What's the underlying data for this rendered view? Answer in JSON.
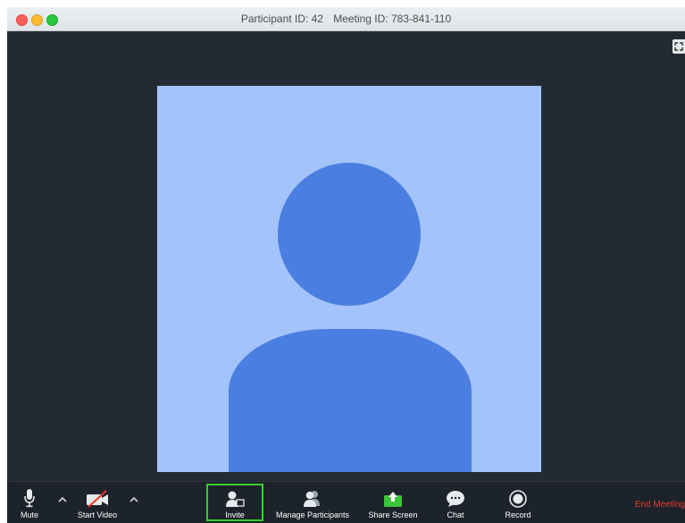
{
  "window": {
    "participant_id": "Participant ID: 42",
    "meeting_id": "Meeting ID: 783-841-110"
  },
  "toolbar": {
    "mute_label": "Mute",
    "start_video_label": "Start Video",
    "invite_label": "Invite",
    "manage_participants_label": "Manage Participants",
    "share_screen_label": "Share Screen",
    "chat_label": "Chat",
    "record_label": "Record",
    "end_meeting_label": "End Meeting"
  },
  "colors": {
    "tile_background": "#a4c3fa",
    "avatar": "#4a7ee0",
    "invite_highlight": "#33d12b",
    "share_screen": "#3cc43a",
    "end_meeting": "#e83a2f"
  }
}
